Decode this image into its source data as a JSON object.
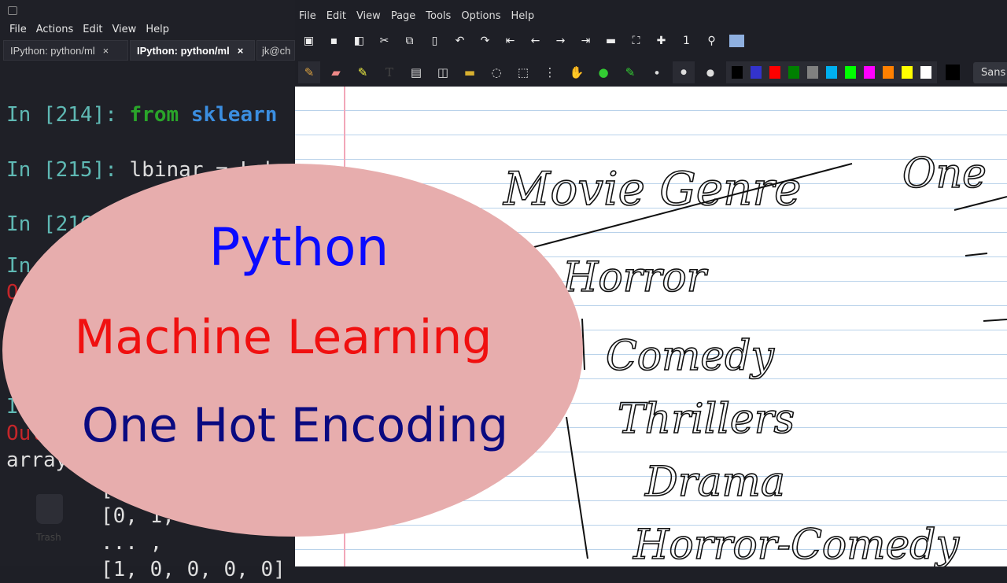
{
  "terminal": {
    "menu": [
      "File",
      "Actions",
      "Edit",
      "View",
      "Help"
    ],
    "tabs": [
      {
        "label": "IPython: python/ml"
      },
      {
        "label": "IPython: python/ml"
      },
      {
        "label": "jk@ch"
      }
    ],
    "close_glyph": "×",
    "lines": [
      {
        "prompt": "In [214]:",
        "code_kw": "from",
        "code_mod": "sklearn"
      },
      {
        "prompt": "In [215]:",
        "code": "lbinar = Lab"
      },
      {
        "prompt": "In [216]"
      },
      {
        "prompt": "In"
      },
      {
        "out": "Ou"
      },
      {
        "prompt": "In"
      },
      {
        "out": "Out"
      },
      {
        "text": "array"
      }
    ],
    "array_lines": [
      "[",
      "[0, 1,",
      "... ,",
      "[1, 0, 0, 0, 0]"
    ],
    "trash_label": "Trash"
  },
  "app": {
    "menu": [
      "File",
      "Edit",
      "View",
      "Page",
      "Tools",
      "Options",
      "Help"
    ],
    "colors": [
      "#000000",
      "#3333cc",
      "#ff0000",
      "#008000",
      "#808080",
      "#00b0f0",
      "#00ff00",
      "#ff00ff",
      "#ff8000",
      "#ffff00",
      "#ffffff"
    ],
    "current_color": "#000000",
    "font_name": "Sans",
    "font_size": "12"
  },
  "notes": {
    "title": "Movie Genre",
    "right": "One",
    "items": [
      "Horror",
      "Comedy",
      "Thrillers",
      "Drama",
      "Horror-Comedy"
    ]
  },
  "overlay": {
    "line1": "Python",
    "line2": "Machine Learning",
    "line3": "One Hot Encoding",
    "color1": "#0a0aff",
    "color2": "#f01010",
    "color3": "#0a0a80",
    "bg": "#e7adad"
  }
}
